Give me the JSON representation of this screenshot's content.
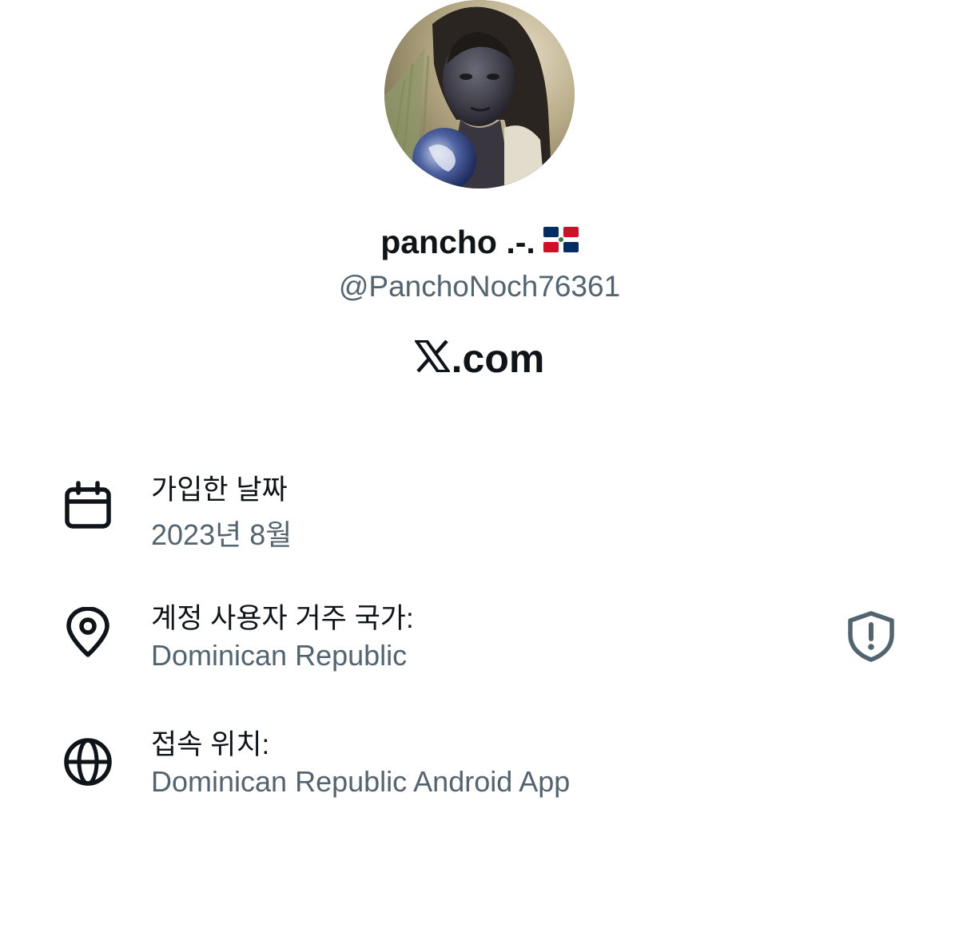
{
  "profile": {
    "display_name": "pancho .-.",
    "flag_icon": "dominican-republic-flag-icon",
    "handle": "@PanchoNoch76361",
    "site": ".com",
    "site_logo_icon": "x-logo-icon"
  },
  "info": {
    "joined": {
      "icon": "calendar-icon",
      "label": "가입한 날짜",
      "value": "2023년 8월"
    },
    "country": {
      "icon": "location-pin-icon",
      "label": "계정 사용자 거주 국가:",
      "value": "Dominican Republic",
      "badge_icon": "shield-alert-icon"
    },
    "access": {
      "icon": "globe-icon",
      "label": "접속 위치:",
      "value": "Dominican Republic Android App"
    }
  },
  "colors": {
    "primary_text": "#0f1419",
    "secondary_text": "#536471",
    "background": "#ffffff"
  }
}
